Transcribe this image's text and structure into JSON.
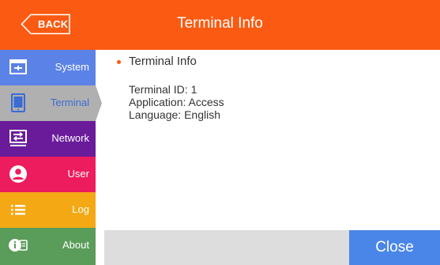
{
  "header": {
    "back_label": "BACK",
    "title": "Terminal Info",
    "color": "#fb5a12"
  },
  "sidebar": {
    "items": [
      {
        "label": "System",
        "icon": "system-window-icon",
        "color": "#5b82e6"
      },
      {
        "label": "Terminal",
        "icon": "tablet-icon",
        "color": "#b0b0b0",
        "active": true
      },
      {
        "label": "Network",
        "icon": "network-transfer-icon",
        "color": "#6a1b9a"
      },
      {
        "label": "User",
        "icon": "user-icon",
        "color": "#ec1c5e"
      },
      {
        "label": "Log",
        "icon": "list-icon",
        "color": "#f4a814"
      },
      {
        "label": "About",
        "icon": "info-icon",
        "color": "#5a9c5a"
      }
    ]
  },
  "content": {
    "section_title": "Terminal Info",
    "lines": [
      "Terminal ID: 1",
      "Application: Access",
      "Language: English"
    ]
  },
  "footer": {
    "close_label": "Close"
  }
}
